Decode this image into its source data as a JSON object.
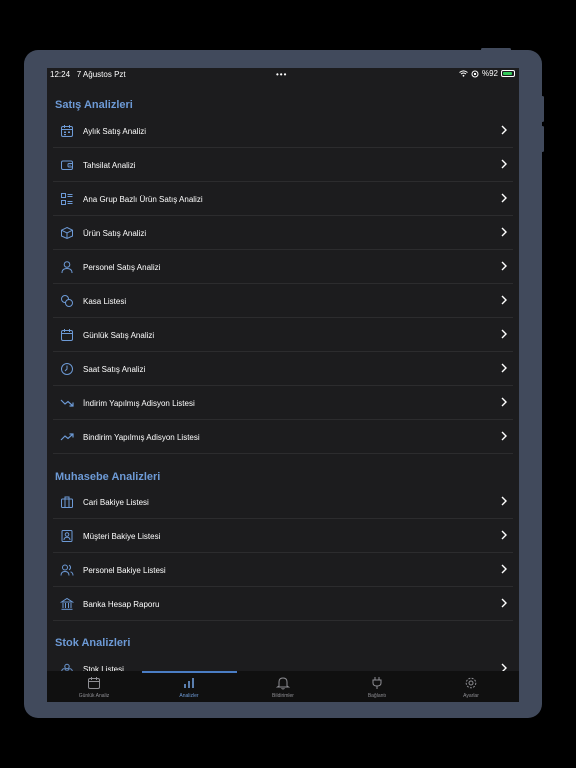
{
  "status_bar": {
    "time": "12:24",
    "date": "7 Ağustos Pzt",
    "dots": "•••",
    "battery": "%92"
  },
  "sections": [
    {
      "title": "Satış Analizleri"
    },
    {
      "title": "Muhasebe Analizleri"
    },
    {
      "title": "Stok Analizleri"
    }
  ],
  "items": [
    {
      "label": "Aylık Satış Analizi",
      "icon": "calendar-icon"
    },
    {
      "label": "Tahsilat Analizi",
      "icon": "wallet-icon"
    },
    {
      "label": "Ana Grup Bazlı Ürün Satış Analizi",
      "icon": "list-icon"
    },
    {
      "label": "Ürün Satış Analizi",
      "icon": "box-icon"
    },
    {
      "label": "Personel Satış Analizi",
      "icon": "person-icon"
    },
    {
      "label": "Kasa Listesi",
      "icon": "coins-icon"
    },
    {
      "label": "Günlük Satış Analizi",
      "icon": "calendar-day-icon"
    },
    {
      "label": "Saat Satış Analizi",
      "icon": "clock-icon"
    },
    {
      "label": "İndirim Yapılmış Adisyon Listesi",
      "icon": "trend-down-icon"
    },
    {
      "label": "Bindirim Yapılmış Adisyon Listesi",
      "icon": "trend-up-icon"
    },
    {
      "label": "Cari Bakiye Listesi",
      "icon": "briefcase-icon"
    },
    {
      "label": "Müşteri Bakiye Listesi",
      "icon": "contact-card-icon"
    },
    {
      "label": "Personel Bakiye Listesi",
      "icon": "people-icon"
    },
    {
      "label": "Banka Hesap Raporu",
      "icon": "bank-icon"
    },
    {
      "label": "Stok Listesi",
      "icon": "stock-icon"
    }
  ],
  "tabs": [
    {
      "label": "Günlük Analiz",
      "icon": "calendar-icon"
    },
    {
      "label": "Analizler",
      "icon": "bar-chart-icon",
      "active": true
    },
    {
      "label": "Bildirimler",
      "icon": "bell-icon"
    },
    {
      "label": "Bağlantı",
      "icon": "plug-icon"
    },
    {
      "label": "Ayarlar",
      "icon": "gear-icon"
    }
  ],
  "colors": {
    "accent": "#6d9ad6",
    "background": "#1c1c1e",
    "frame": "#414a5c"
  }
}
